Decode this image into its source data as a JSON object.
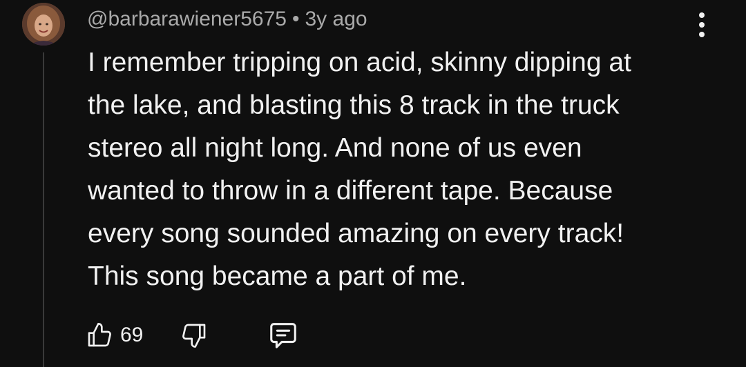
{
  "comment": {
    "author": "@barbarawiener5675",
    "separator": "•",
    "time": "3y ago",
    "text": "I remember tripping on acid, skinny dipping at\nthe lake, and blasting this 8 track in the truck\nstereo all night long. And none of us even\nwanted to throw in a different tape. Because\nevery song sounded amazing on every track!\nThis song became a part of me.",
    "like_count": "69"
  },
  "icons": {
    "like": "thumbs-up-icon",
    "dislike": "thumbs-down-icon",
    "reply": "reply-comment-icon",
    "more": "more-vertical-icon"
  },
  "colors": {
    "background": "#0f0f0f",
    "text_primary": "#f1f1f1",
    "text_secondary": "#aaaaaa",
    "thread_line": "#3a3a3a"
  }
}
